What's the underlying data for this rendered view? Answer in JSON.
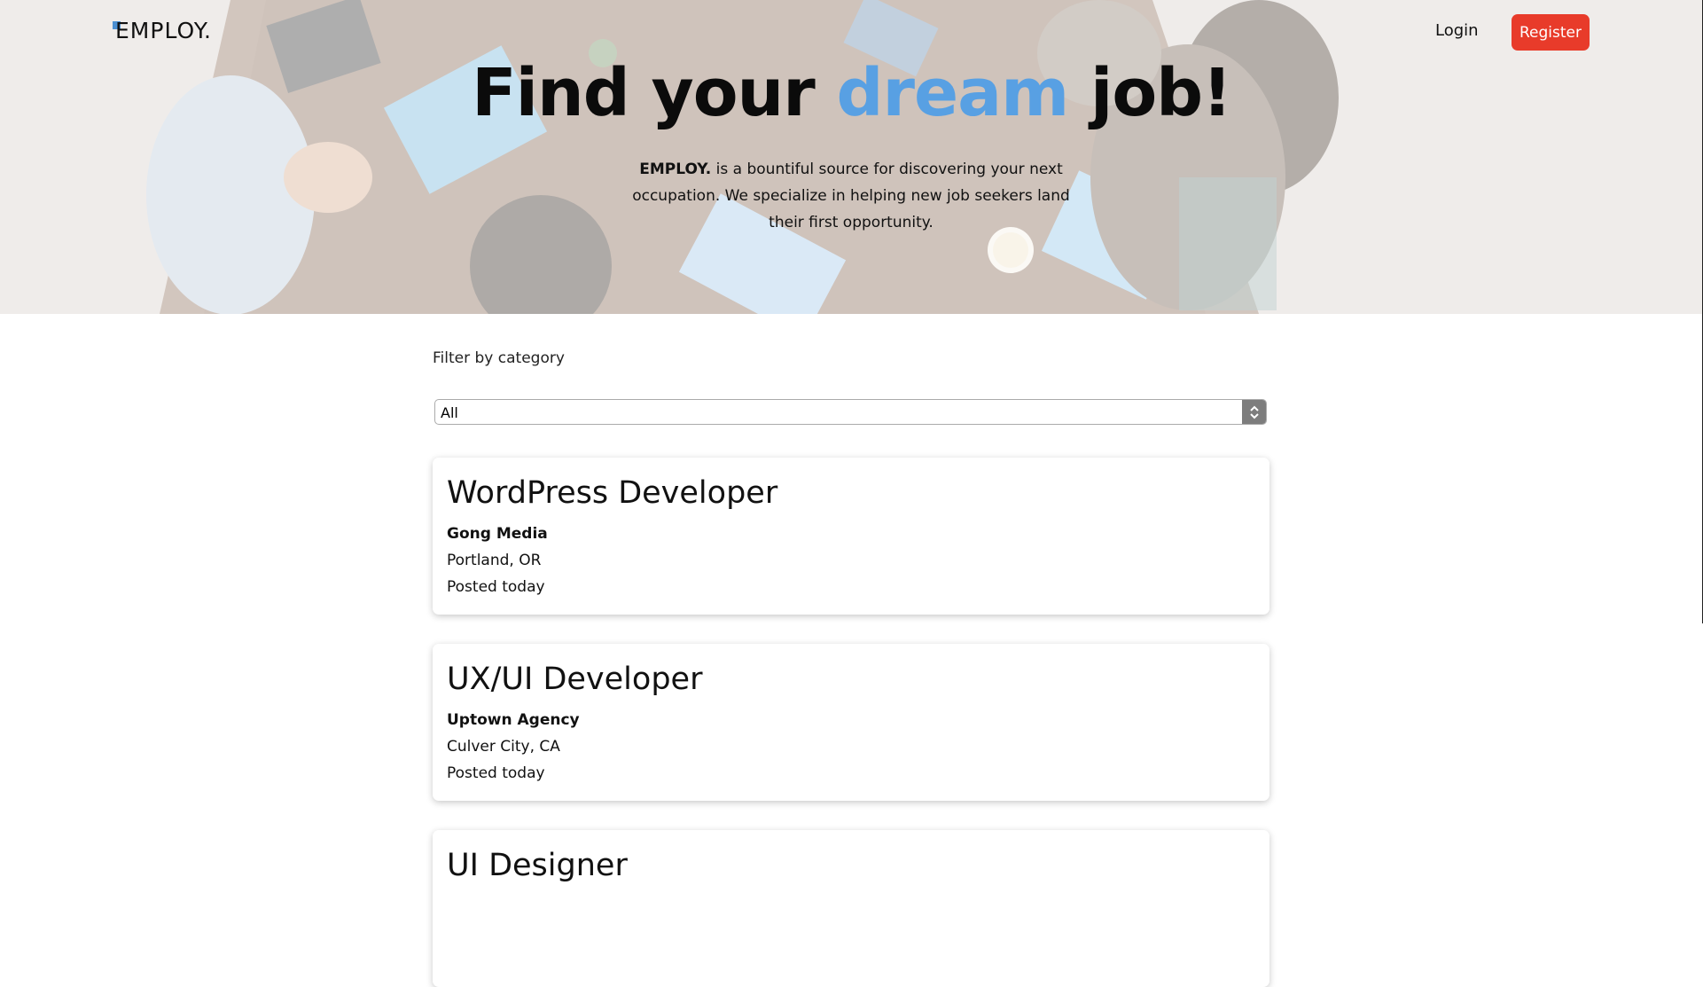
{
  "header": {
    "logo": "EMPLOY.",
    "login_label": "Login",
    "register_label": "Register",
    "accent_color": "#e83b2a"
  },
  "hero": {
    "headline_before": "Find your ",
    "headline_accent": "dream",
    "headline_after": " job!",
    "accent_color": "#58a0e3",
    "intro_brand": "EMPLOY.",
    "intro_text": " is a bountiful source for discovering your next occupation. We specialize in helping new job seekers land their first opportunity."
  },
  "filter": {
    "label": "Filter by category",
    "selected": "All",
    "icon": "chevron-up-down-icon"
  },
  "jobs": [
    {
      "title": "WordPress Developer",
      "company": "Gong Media",
      "location": "Portland, OR",
      "posted": "Posted today"
    },
    {
      "title": "UX/UI Developer",
      "company": "Uptown Agency",
      "location": "Culver City, CA",
      "posted": "Posted today"
    },
    {
      "title": "UI Designer",
      "company": "",
      "location": "",
      "posted": ""
    }
  ]
}
